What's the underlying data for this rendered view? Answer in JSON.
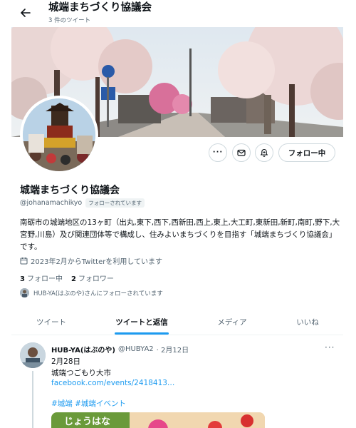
{
  "header": {
    "title": "城端まちづくり協議会",
    "tweet_count": "3 件のツイート"
  },
  "profile": {
    "name": "城端まちづくり協議会",
    "handle": "@johanamachikyo",
    "follows_you": "フォローされています",
    "bio": "南砺市の城端地区の13ヶ町（出丸,東下,西下,西新田,西上,東上,大工町,東新田,新町,南町,野下,大宮野,川島）及び関連団体等で構成し、住みよいまちづくりを目指す「城端まちづくり協議会」です。",
    "joined": "2023年2月からTwitterを利用しています",
    "following_count": "3",
    "following_label": "フォロー中",
    "followers_count": "2",
    "followers_label": "フォロワー",
    "followed_by": "HUB-YA(はぶのや)さんにフォローされています"
  },
  "actions": {
    "follow_label": "フォロー中"
  },
  "tabs": [
    {
      "label": "ツイート",
      "active": false
    },
    {
      "label": "ツイートと返信",
      "active": true
    },
    {
      "label": "メディア",
      "active": false
    },
    {
      "label": "いいね",
      "active": false
    }
  ],
  "tweet": {
    "author": "HUB-YA(はぶのや)",
    "handle": "@HUBYA2",
    "date": "· 2月12日",
    "line1": "2月28日",
    "line2": "城端つごもり大市",
    "link": "facebook.com/events/2418413…",
    "hashtags": "#城端 #城端イベント",
    "media_text": "じょうはな"
  },
  "colors": {
    "accent": "#1d9bf0",
    "text": "#0f1419",
    "muted": "#536471"
  }
}
